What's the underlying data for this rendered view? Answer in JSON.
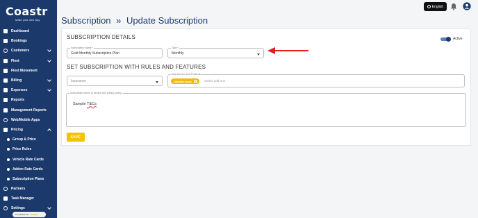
{
  "brand": {
    "name": "Coastr",
    "tagline": "Make your own way"
  },
  "sidebar": {
    "items": [
      {
        "label": "Dashboard",
        "icon": "grid-icon"
      },
      {
        "label": "Bookings",
        "icon": "calendar-icon"
      },
      {
        "label": "Customers",
        "icon": "users-icon",
        "expandable": true
      },
      {
        "label": "Fleet",
        "icon": "car-icon",
        "expandable": true
      },
      {
        "label": "Fleet Movement",
        "icon": "truck-icon"
      },
      {
        "label": "Billing",
        "icon": "receipt-icon",
        "expandable": true
      },
      {
        "label": "Expenses",
        "icon": "wallet-icon",
        "expandable": true
      },
      {
        "label": "Reports",
        "icon": "report-icon"
      },
      {
        "label": "Management Reports",
        "icon": "chart-icon"
      },
      {
        "label": "Web/Mobile Apps",
        "icon": "globe-icon"
      },
      {
        "label": "Pricing",
        "icon": "tag-icon",
        "expanded": true
      },
      {
        "label": "Group & Price",
        "sub": true
      },
      {
        "label": "Price Rules",
        "sub": true
      },
      {
        "label": "Vehicle Rate Cards",
        "sub": true
      },
      {
        "label": "Addon Rate Cards",
        "sub": true
      },
      {
        "label": "Subscription Plans",
        "sub": true
      },
      {
        "label": "Partners",
        "icon": "handshake-icon"
      },
      {
        "label": "Task Manager",
        "icon": "clipboard-icon"
      },
      {
        "label": "Settings",
        "icon": "gear-icon",
        "expandable": true
      }
    ],
    "powered_by": "POWERED BY",
    "powered_brand": "Coastr"
  },
  "topbar": {
    "language": "English"
  },
  "breadcrumb": {
    "parent": "Subscription",
    "separator": "»",
    "current": "Update Subscription"
  },
  "form": {
    "details_title": "SUBSCRIPTION DETAILS",
    "active_label": "Active",
    "active": true,
    "name_label": "Subscription Name *",
    "name_value": "Gold Monthly Subscription Plan",
    "type_label": "Type *",
    "type_value": "Monthly",
    "rules_title": "SET SUBSCRIPTION WITH RULES AND FEATURES",
    "category_value": "Insurance",
    "addon_label": "Add add-ons and Products",
    "addon_chip": "Ultimate pack",
    "addon_placeholder": "Select add-ons",
    "terms_label": "Subscription terms of service and privacy policy",
    "terms_prefix": "Sample ",
    "terms_highlight": "T&Cs",
    "save_label": "SAVE"
  },
  "colors": {
    "sidebar": "#1b3a6b",
    "accent": "#f5c20a",
    "arrow": "#e02020"
  }
}
